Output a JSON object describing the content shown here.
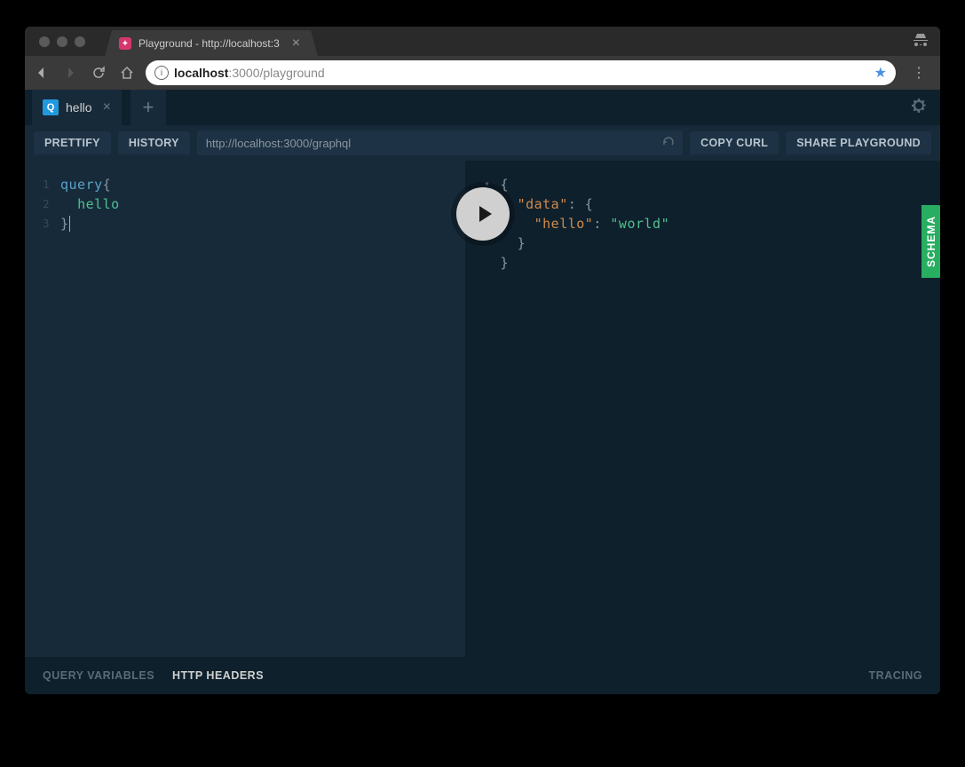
{
  "browser": {
    "tab_title": "Playground - http://localhost:3",
    "url_host": "localhost",
    "url_port_path": ":3000/playground"
  },
  "playground": {
    "tab": {
      "badge": "Q",
      "name": "hello"
    },
    "toolbar": {
      "prettify": "PRETTIFY",
      "history": "HISTORY",
      "endpoint": "http://localhost:3000/graphql",
      "copy_curl": "COPY CURL",
      "share": "SHARE PLAYGROUND"
    },
    "editor": {
      "lines": [
        "1",
        "2",
        "3"
      ],
      "line1_kw": "query",
      "line1_brace": "{",
      "line2_field": "hello",
      "line3_brace": "}"
    },
    "response": {
      "l1": "{",
      "l2_key": "\"data\"",
      "l2_rest": ": {",
      "l3_key": "\"hello\"",
      "l3_colon": ": ",
      "l3_val": "\"world\"",
      "l4": "}",
      "l5": "}"
    },
    "sidebar": {
      "schema": "SCHEMA"
    },
    "footer": {
      "query_vars": "QUERY VARIABLES",
      "http_headers": "HTTP HEADERS",
      "tracing": "TRACING"
    }
  }
}
